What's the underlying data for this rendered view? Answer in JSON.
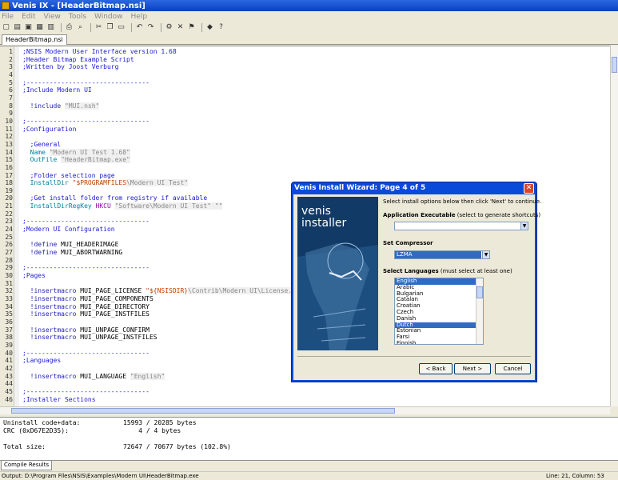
{
  "app": {
    "title": "Venis IX - [HeaderBitmap.nsi]"
  },
  "menu": [
    "File",
    "Edit",
    "View",
    "Tools",
    "Window",
    "Help"
  ],
  "doc_tab": "HeaderBitmap.nsi",
  "code_lines": [
    [
      {
        "c": ";NSIS Modern User Interface version 1.68",
        "t": "cm"
      }
    ],
    [
      {
        "c": ";Header Bitmap Example Script",
        "t": "cm"
      }
    ],
    [
      {
        "c": ";Written by Joost Verburg",
        "t": "cm"
      }
    ],
    [
      {
        "c": "",
        "t": ""
      }
    ],
    [
      {
        "c": ";--------------------------------",
        "t": "cm"
      }
    ],
    [
      {
        "c": ";Include Modern UI",
        "t": "cm"
      }
    ],
    [
      {
        "c": "",
        "t": ""
      }
    ],
    [
      {
        "c": "  !include ",
        "t": "kw"
      },
      {
        "c": "\"MUI.nsh\"",
        "t": "str"
      }
    ],
    [
      {
        "c": "",
        "t": ""
      }
    ],
    [
      {
        "c": ";--------------------------------",
        "t": "cm"
      }
    ],
    [
      {
        "c": ";Configuration",
        "t": "cm"
      }
    ],
    [
      {
        "c": "",
        "t": ""
      }
    ],
    [
      {
        "c": "  ;General",
        "t": "cm"
      }
    ],
    [
      {
        "c": "  Name ",
        "t": "cmd"
      },
      {
        "c": "\"Modern UI Test 1.68\"",
        "t": "str"
      }
    ],
    [
      {
        "c": "  OutFile ",
        "t": "cmd"
      },
      {
        "c": "\"HeaderBitmap.exe\"",
        "t": "str"
      }
    ],
    [
      {
        "c": "",
        "t": ""
      }
    ],
    [
      {
        "c": "  ;Folder selection page",
        "t": "cm"
      }
    ],
    [
      {
        "c": "  InstallDir ",
        "t": "cmd"
      },
      {
        "c": "\"$PROGRAMFILES",
        "t": "var"
      },
      {
        "c": "\\Modern UI Test\"",
        "t": "str"
      }
    ],
    [
      {
        "c": "",
        "t": ""
      }
    ],
    [
      {
        "c": "  ;Get install folder from registry if available",
        "t": "cm"
      }
    ],
    [
      {
        "c": "  InstallDirRegKey ",
        "t": "cmd"
      },
      {
        "c": "HKCU ",
        "t": "reg"
      },
      {
        "c": "\"Software\\Modern UI Test\" \"\"",
        "t": "str"
      }
    ],
    [
      {
        "c": "",
        "t": ""
      }
    ],
    [
      {
        "c": ";--------------------------------",
        "t": "cm"
      }
    ],
    [
      {
        "c": ";Modern UI Configuration",
        "t": "cm"
      }
    ],
    [
      {
        "c": "",
        "t": ""
      }
    ],
    [
      {
        "c": "  !define ",
        "t": "kw"
      },
      {
        "c": "MUI_HEADERIMAGE",
        "t": ""
      }
    ],
    [
      {
        "c": "  !define ",
        "t": "kw"
      },
      {
        "c": "MUI_ABORTWARNING",
        "t": ""
      }
    ],
    [
      {
        "c": "",
        "t": ""
      }
    ],
    [
      {
        "c": ";--------------------------------",
        "t": "cm"
      }
    ],
    [
      {
        "c": ";Pages",
        "t": "cm"
      }
    ],
    [
      {
        "c": "",
        "t": ""
      }
    ],
    [
      {
        "c": "  !insertmacro ",
        "t": "kw"
      },
      {
        "c": "MUI_PAGE_LICENSE ",
        "t": ""
      },
      {
        "c": "\"${NSISDIR}",
        "t": "var"
      },
      {
        "c": "\\Contrib\\Modern UI\\License.",
        "t": "str"
      }
    ],
    [
      {
        "c": "  !insertmacro ",
        "t": "kw"
      },
      {
        "c": "MUI_PAGE_COMPONENTS",
        "t": ""
      }
    ],
    [
      {
        "c": "  !insertmacro ",
        "t": "kw"
      },
      {
        "c": "MUI_PAGE_DIRECTORY",
        "t": ""
      }
    ],
    [
      {
        "c": "  !insertmacro ",
        "t": "kw"
      },
      {
        "c": "MUI_PAGE_INSTFILES",
        "t": ""
      }
    ],
    [
      {
        "c": "",
        "t": ""
      }
    ],
    [
      {
        "c": "  !insertmacro ",
        "t": "kw"
      },
      {
        "c": "MUI_UNPAGE_CONFIRM",
        "t": ""
      }
    ],
    [
      {
        "c": "  !insertmacro ",
        "t": "kw"
      },
      {
        "c": "MUI_UNPAGE_INSTFILES",
        "t": ""
      }
    ],
    [
      {
        "c": "",
        "t": ""
      }
    ],
    [
      {
        "c": ";--------------------------------",
        "t": "cm"
      }
    ],
    [
      {
        "c": ";Languages",
        "t": "cm"
      }
    ],
    [
      {
        "c": "",
        "t": ""
      }
    ],
    [
      {
        "c": "  !insertmacro ",
        "t": "kw"
      },
      {
        "c": "MUI_LANGUAGE ",
        "t": ""
      },
      {
        "c": "\"English\"",
        "t": "str"
      }
    ],
    [
      {
        "c": "",
        "t": ""
      }
    ],
    [
      {
        "c": ";--------------------------------",
        "t": "cm"
      }
    ],
    [
      {
        "c": ";Installer Sections",
        "t": "cm"
      }
    ]
  ],
  "output": [
    {
      "l": "Uninstall code+data:",
      "r": "15993 / 20285 bytes"
    },
    {
      "l": "CRC (0xD67E2D35):",
      "r": "    4 / 4 bytes"
    },
    {
      "l": "",
      "r": ""
    },
    {
      "l": "Total size:",
      "r": "72647 / 70677 bytes (102.8%)"
    }
  ],
  "bottom_tab": "Compile Results",
  "status": {
    "left": "Output: D:\\Program Files\\NSIS\\Examples\\Modern UI\\HeaderBitmap.exe",
    "right": "Line: 21, Column: 53"
  },
  "dialog": {
    "title": "Venis Install Wizard: Page 4 of 5",
    "banner_line1": "venis",
    "banner_line2": "installer",
    "intro": "Select install options below then click 'Next' to continue.",
    "app_exe_label": "Application Executable",
    "app_exe_hint": "(select to generate shortcuts)",
    "app_exe_value": "",
    "compressor_label": "Set Compressor",
    "compressor_value": "LZMA",
    "languages_label": "Select Languages",
    "languages_hint": "(must select at least one)",
    "languages": [
      {
        "name": "English",
        "selected": true
      },
      {
        "name": "Arabic",
        "selected": false
      },
      {
        "name": "Bulgarian",
        "selected": false
      },
      {
        "name": "Catalan",
        "selected": false
      },
      {
        "name": "Croatian",
        "selected": false
      },
      {
        "name": "Czech",
        "selected": false
      },
      {
        "name": "Danish",
        "selected": false
      },
      {
        "name": "Dutch",
        "selected": true
      },
      {
        "name": "Estonian",
        "selected": false
      },
      {
        "name": "Farsi",
        "selected": false
      },
      {
        "name": "Finnish",
        "selected": false
      }
    ],
    "back": "< Back",
    "next": "Next >",
    "cancel": "Cancel"
  },
  "colors": {
    "title_bar": "#0a3fc2",
    "selection": "#316ac5",
    "comment": "#1a1ad0",
    "banner": "#123a66"
  }
}
